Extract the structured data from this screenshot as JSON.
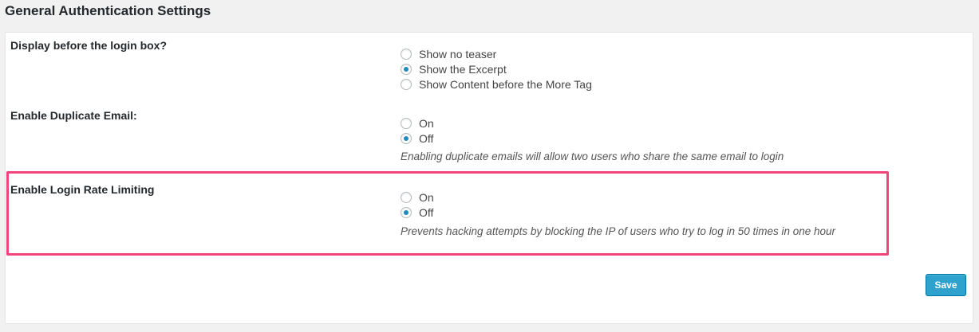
{
  "page": {
    "section_title": "General Authentication Settings"
  },
  "settings": [
    {
      "label": "Display before the login box?",
      "options": [
        "Show no teaser",
        "Show the Excerpt",
        "Show Content before the More Tag"
      ],
      "selected": "Show the Excerpt",
      "description": ""
    },
    {
      "label": "Enable Duplicate Email:",
      "options": [
        "On",
        "Off"
      ],
      "selected": "Off",
      "description": "Enabling duplicate emails will allow two users who share the same email to login"
    },
    {
      "label": "Enable Login Rate Limiting",
      "options": [
        "On",
        "Off"
      ],
      "selected": "Off",
      "description": "Prevents hacking attempts by blocking the IP of users who try to log in 50 times in one hour"
    }
  ],
  "actions": {
    "save_label": "Save"
  },
  "colors": {
    "accent": "#2ea2cc",
    "highlight": "#f0457b",
    "radio_checked": "#1e8cbe"
  }
}
